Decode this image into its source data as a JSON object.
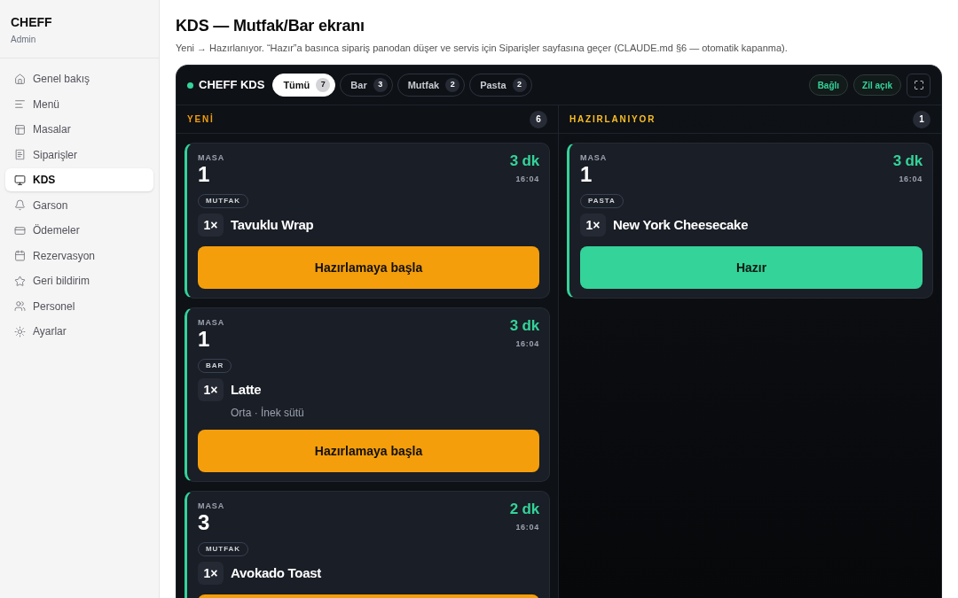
{
  "sidebar": {
    "brand": "CHEFF",
    "role": "Admin",
    "items": [
      {
        "label": "Genel bakış",
        "selected": false
      },
      {
        "label": "Menü",
        "selected": false
      },
      {
        "label": "Masalar",
        "selected": false
      },
      {
        "label": "Siparişler",
        "selected": false
      },
      {
        "label": "KDS",
        "selected": true
      },
      {
        "label": "Garson",
        "selected": false
      },
      {
        "label": "Ödemeler",
        "selected": false
      },
      {
        "label": "Rezervasyon",
        "selected": false
      },
      {
        "label": "Geri bildirim",
        "selected": false
      },
      {
        "label": "Personel",
        "selected": false
      },
      {
        "label": "Ayarlar",
        "selected": false
      }
    ]
  },
  "page": {
    "title": "KDS — Mutfak/Bar ekranı",
    "subtitle": "Yeni → Hazırlanıyor. “Hazır”a basınca sipariş panodan düşer ve servis için Siparişler sayfasına geçer (CLAUDE.md §6 — otomatik kapanma)."
  },
  "kds": {
    "title": "CHEFF KDS",
    "online": true,
    "tabs": [
      {
        "label": "Tümü",
        "count": "7",
        "selected": true
      },
      {
        "label": "Bar",
        "count": "3",
        "selected": false
      },
      {
        "label": "Mutfak",
        "count": "2",
        "selected": false
      },
      {
        "label": "Pasta",
        "count": "2",
        "selected": false
      }
    ],
    "status_pills": [
      "Bağlı",
      "Zil açık"
    ],
    "columns": [
      {
        "title": "YENİ",
        "count": "6",
        "kind": "new",
        "cards": [
          {
            "table_label": "MASA",
            "table": "1",
            "elapsed": "3 dk",
            "time": "16:04",
            "station": "MUTFAK",
            "items": [
              {
                "qty": "1×",
                "name": "Tavuklu Wrap"
              }
            ],
            "action": {
              "kind": "start",
              "label": "Hazırlamaya başla"
            }
          },
          {
            "table_label": "MASA",
            "table": "1",
            "elapsed": "3 dk",
            "time": "16:04",
            "station": "BAR",
            "items": [
              {
                "qty": "1×",
                "name": "Latte",
                "note": "Orta · İnek sütü"
              }
            ],
            "action": {
              "kind": "start",
              "label": "Hazırlamaya başla"
            }
          },
          {
            "table_label": "MASA",
            "table": "3",
            "elapsed": "2 dk",
            "time": "16:04",
            "station": "MUTFAK",
            "items": [
              {
                "qty": "1×",
                "name": "Avokado Toast"
              }
            ],
            "action": {
              "kind": "start"
            }
          }
        ]
      },
      {
        "title": "HAZIRLANIYOR",
        "count": "1",
        "kind": "preparing",
        "cards": [
          {
            "table_label": "MASA",
            "table": "1",
            "elapsed": "3 dk",
            "time": "16:04",
            "station": "PASTA",
            "items": [
              {
                "qty": "1×",
                "name": "New York Cheesecake"
              }
            ],
            "action": {
              "kind": "ready",
              "label": "Hazır"
            }
          }
        ]
      }
    ]
  }
}
